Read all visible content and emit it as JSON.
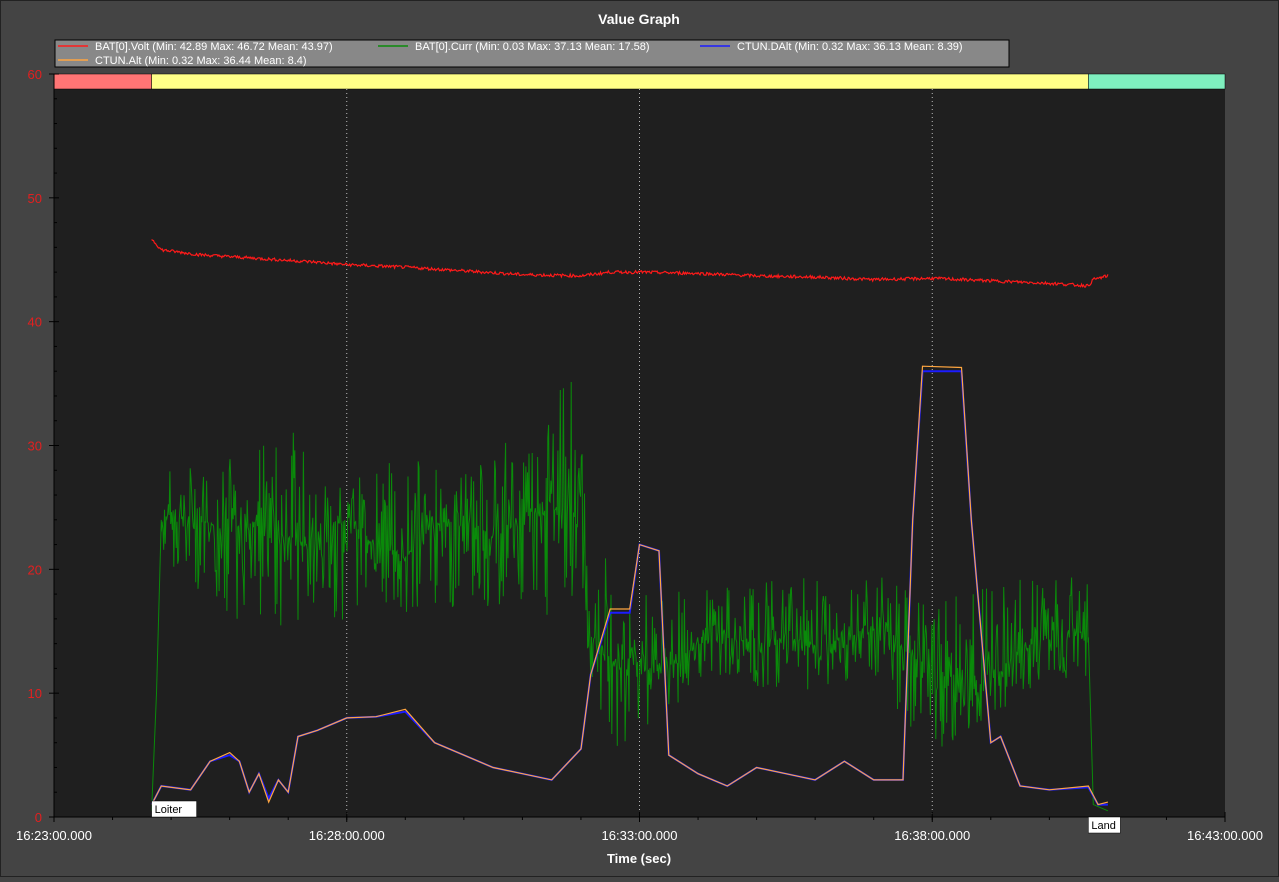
{
  "window": {
    "title": "Value Graph"
  },
  "colors": {
    "background": "#444444",
    "plot_background": "#1f1f1f",
    "voltage": "#ff1a1a",
    "current": "#0a8a0a",
    "dalt": "#1c1cff",
    "alt": "#ffa640",
    "y_axis_text": "#e41f1f",
    "grid": "#bbbbbb"
  },
  "modes": [
    {
      "name": "",
      "start": "16:23:00",
      "end": "16:24:40",
      "color": "#ff7575"
    },
    {
      "name": "Loiter",
      "start": "16:24:40",
      "end": "16:40:40",
      "color": "#ffff88"
    },
    {
      "name": "Land",
      "start": "16:40:40",
      "end": "16:43:00",
      "color": "#7fefbf"
    }
  ],
  "chart_data": {
    "type": "line",
    "title": "Value Graph",
    "xlabel": "Time (sec)",
    "ylabel": "",
    "xlim": [
      "16:23:00",
      "16:43:00"
    ],
    "ylim": [
      0,
      60
    ],
    "x_ticks": [
      "16:23:00.000",
      "16:28:00.000",
      "16:33:00.000",
      "16:38:00.000",
      "16:43:00.000"
    ],
    "y_ticks": [
      0,
      10,
      20,
      30,
      40,
      50,
      60
    ],
    "grid": "vertical dotted",
    "legend": "top-left",
    "series": [
      {
        "name": "BAT[0].Volt",
        "stats": "(Min: 42.89 Max: 46.72 Mean: 43.97)",
        "color": "#ff1a1a",
        "points": [
          [
            "16:24:40",
            46.7
          ],
          [
            "16:24:50",
            45.8
          ],
          [
            "16:25:30",
            45.4
          ],
          [
            "16:26:30",
            45.1
          ],
          [
            "16:27:30",
            44.8
          ],
          [
            "16:28:00",
            44.6
          ],
          [
            "16:29:00",
            44.4
          ],
          [
            "16:30:00",
            44.1
          ],
          [
            "16:31:00",
            43.8
          ],
          [
            "16:32:00",
            43.7
          ],
          [
            "16:32:30",
            44.0
          ],
          [
            "16:33:00",
            44.0
          ],
          [
            "16:34:00",
            43.9
          ],
          [
            "16:35:00",
            43.7
          ],
          [
            "16:36:00",
            43.6
          ],
          [
            "16:37:00",
            43.4
          ],
          [
            "16:38:00",
            43.5
          ],
          [
            "16:39:00",
            43.3
          ],
          [
            "16:40:00",
            43.1
          ],
          [
            "16:40:40",
            42.9
          ],
          [
            "16:40:45",
            43.4
          ],
          [
            "16:41:00",
            43.7
          ]
        ]
      },
      {
        "name": "BAT[0].Curr",
        "stats": "(Min: 0.03 Max: 37.13 Mean: 17.58)",
        "color": "#0a8a0a",
        "points": [
          [
            "16:24:40",
            0.5
          ],
          [
            "16:24:45",
            10.0
          ],
          [
            "16:24:50",
            24.0
          ],
          [
            "16:25:00",
            24.5
          ],
          [
            "16:25:30",
            24.0
          ],
          [
            "16:26:00",
            23.0
          ],
          [
            "16:26:30",
            24.0
          ],
          [
            "16:27:00",
            22.5
          ],
          [
            "16:27:30",
            23.0
          ],
          [
            "16:28:00",
            24.0
          ],
          [
            "16:28:30",
            22.0
          ],
          [
            "16:29:00",
            21.0
          ],
          [
            "16:29:30",
            23.5
          ],
          [
            "16:30:00",
            24.5
          ],
          [
            "16:30:30",
            22.5
          ],
          [
            "16:31:00",
            24.0
          ],
          [
            "16:31:30",
            25.0
          ],
          [
            "16:32:00",
            24.0
          ],
          [
            "16:32:10",
            15.0
          ],
          [
            "16:32:30",
            12.5
          ],
          [
            "16:33:00",
            13.0
          ],
          [
            "16:33:30",
            12.0
          ],
          [
            "16:34:00",
            14.0
          ],
          [
            "16:34:30",
            14.5
          ],
          [
            "16:35:00",
            14.0
          ],
          [
            "16:35:30",
            14.5
          ],
          [
            "16:36:00",
            14.0
          ],
          [
            "16:36:30",
            14.5
          ],
          [
            "16:37:00",
            15.0
          ],
          [
            "16:37:30",
            13.5
          ],
          [
            "16:38:00",
            12.0
          ],
          [
            "16:38:30",
            10.5
          ],
          [
            "16:39:00",
            11.0
          ],
          [
            "16:39:30",
            13.5
          ],
          [
            "16:40:00",
            14.5
          ],
          [
            "16:40:30",
            15.0
          ],
          [
            "16:40:40",
            14.5
          ],
          [
            "16:40:45",
            1.0
          ],
          [
            "16:41:00",
            0.5
          ]
        ],
        "range_min": [
          [
            "16:24:50",
            21.0
          ],
          [
            "16:26:00",
            16.0
          ],
          [
            "16:27:00",
            15.0
          ],
          [
            "16:28:00",
            16.0
          ],
          [
            "16:29:00",
            16.0
          ],
          [
            "16:30:00",
            17.0
          ],
          [
            "16:31:00",
            16.0
          ],
          [
            "16:32:00",
            14.0
          ],
          [
            "16:32:30",
            4.0
          ],
          [
            "16:33:00",
            7.0
          ],
          [
            "16:34:00",
            9.5
          ],
          [
            "16:35:00",
            10.0
          ],
          [
            "16:36:00",
            10.0
          ],
          [
            "16:37:00",
            10.5
          ],
          [
            "16:38:00",
            5.0
          ],
          [
            "16:38:30",
            6.0
          ],
          [
            "16:39:00",
            8.0
          ],
          [
            "16:40:00",
            11.0
          ],
          [
            "16:40:40",
            11.0
          ]
        ],
        "range_max": [
          [
            "16:24:50",
            28.0
          ],
          [
            "16:26:00",
            29.0
          ],
          [
            "16:27:00",
            31.5
          ],
          [
            "16:28:00",
            27.0
          ],
          [
            "16:29:00",
            29.5
          ],
          [
            "16:30:00",
            28.0
          ],
          [
            "16:31:00",
            32.0
          ],
          [
            "16:31:50",
            37.1
          ],
          [
            "16:32:00",
            30.0
          ],
          [
            "16:32:30",
            20.0
          ],
          [
            "16:33:00",
            18.0
          ],
          [
            "16:34:00",
            18.5
          ],
          [
            "16:35:00",
            19.0
          ],
          [
            "16:36:00",
            19.5
          ],
          [
            "16:37:00",
            20.0
          ],
          [
            "16:38:00",
            17.0
          ],
          [
            "16:38:30",
            18.0
          ],
          [
            "16:39:00",
            19.0
          ],
          [
            "16:40:00",
            20.0
          ],
          [
            "16:40:40",
            19.0
          ]
        ]
      },
      {
        "name": "CTUN.DAlt",
        "stats": "(Min: 0.32 Max: 36.13 Mean: 8.39)",
        "color": "#1c1cff",
        "points": [
          [
            "16:24:40",
            1.0
          ],
          [
            "16:24:50",
            2.5
          ],
          [
            "16:25:20",
            2.2
          ],
          [
            "16:25:40",
            4.5
          ],
          [
            "16:26:00",
            5.0
          ],
          [
            "16:26:10",
            4.5
          ],
          [
            "16:26:20",
            2.0
          ],
          [
            "16:26:30",
            3.5
          ],
          [
            "16:26:40",
            1.5
          ],
          [
            "16:26:50",
            3.0
          ],
          [
            "16:27:00",
            2.0
          ],
          [
            "16:27:10",
            6.5
          ],
          [
            "16:27:30",
            7.0
          ],
          [
            "16:28:00",
            8.0
          ],
          [
            "16:28:30",
            8.1
          ],
          [
            "16:29:00",
            8.5
          ],
          [
            "16:29:30",
            6.0
          ],
          [
            "16:30:00",
            5.0
          ],
          [
            "16:30:30",
            4.0
          ],
          [
            "16:31:00",
            3.5
          ],
          [
            "16:31:30",
            3.0
          ],
          [
            "16:32:00",
            5.5
          ],
          [
            "16:32:10",
            11.5
          ],
          [
            "16:32:30",
            16.5
          ],
          [
            "16:32:50",
            16.5
          ],
          [
            "16:33:00",
            22.0
          ],
          [
            "16:33:20",
            21.5
          ],
          [
            "16:33:30",
            5.0
          ],
          [
            "16:34:00",
            3.5
          ],
          [
            "16:34:30",
            2.5
          ],
          [
            "16:35:00",
            4.0
          ],
          [
            "16:35:30",
            3.5
          ],
          [
            "16:36:00",
            3.0
          ],
          [
            "16:36:30",
            4.5
          ],
          [
            "16:37:00",
            3.0
          ],
          [
            "16:37:30",
            3.0
          ],
          [
            "16:37:40",
            24.0
          ],
          [
            "16:37:50",
            36.0
          ],
          [
            "16:38:30",
            36.0
          ],
          [
            "16:38:40",
            24.0
          ],
          [
            "16:39:00",
            6.0
          ],
          [
            "16:39:10",
            6.5
          ],
          [
            "16:39:30",
            2.5
          ],
          [
            "16:40:00",
            2.2
          ],
          [
            "16:40:40",
            2.4
          ],
          [
            "16:40:50",
            1.0
          ],
          [
            "16:41:00",
            1.0
          ]
        ]
      },
      {
        "name": "CTUN.Alt",
        "stats": "(Min: 0.32 Max: 36.44 Mean: 8.4)",
        "color": "#ffa640",
        "points": [
          [
            "16:24:40",
            1.0
          ],
          [
            "16:24:50",
            2.5
          ],
          [
            "16:25:20",
            2.2
          ],
          [
            "16:25:40",
            4.5
          ],
          [
            "16:26:00",
            5.2
          ],
          [
            "16:26:10",
            4.5
          ],
          [
            "16:26:20",
            2.0
          ],
          [
            "16:26:30",
            3.5
          ],
          [
            "16:26:40",
            1.2
          ],
          [
            "16:26:50",
            3.0
          ],
          [
            "16:27:00",
            2.0
          ],
          [
            "16:27:10",
            6.5
          ],
          [
            "16:27:30",
            7.0
          ],
          [
            "16:28:00",
            8.0
          ],
          [
            "16:28:30",
            8.1
          ],
          [
            "16:29:00",
            8.7
          ],
          [
            "16:29:30",
            6.0
          ],
          [
            "16:30:00",
            5.0
          ],
          [
            "16:30:30",
            4.0
          ],
          [
            "16:31:00",
            3.5
          ],
          [
            "16:31:30",
            3.0
          ],
          [
            "16:32:00",
            5.5
          ],
          [
            "16:32:10",
            11.5
          ],
          [
            "16:32:30",
            16.8
          ],
          [
            "16:32:50",
            16.8
          ],
          [
            "16:33:00",
            22.0
          ],
          [
            "16:33:20",
            21.5
          ],
          [
            "16:33:30",
            5.0
          ],
          [
            "16:34:00",
            3.5
          ],
          [
            "16:34:30",
            2.5
          ],
          [
            "16:35:00",
            4.0
          ],
          [
            "16:35:30",
            3.5
          ],
          [
            "16:36:00",
            3.0
          ],
          [
            "16:36:30",
            4.5
          ],
          [
            "16:37:00",
            3.0
          ],
          [
            "16:37:30",
            3.0
          ],
          [
            "16:37:40",
            24.0
          ],
          [
            "16:37:50",
            36.4
          ],
          [
            "16:38:30",
            36.3
          ],
          [
            "16:38:40",
            24.0
          ],
          [
            "16:39:00",
            6.0
          ],
          [
            "16:39:10",
            6.5
          ],
          [
            "16:39:30",
            2.5
          ],
          [
            "16:40:00",
            2.2
          ],
          [
            "16:40:40",
            2.5
          ],
          [
            "16:40:50",
            1.0
          ],
          [
            "16:41:00",
            1.2
          ]
        ]
      }
    ]
  }
}
